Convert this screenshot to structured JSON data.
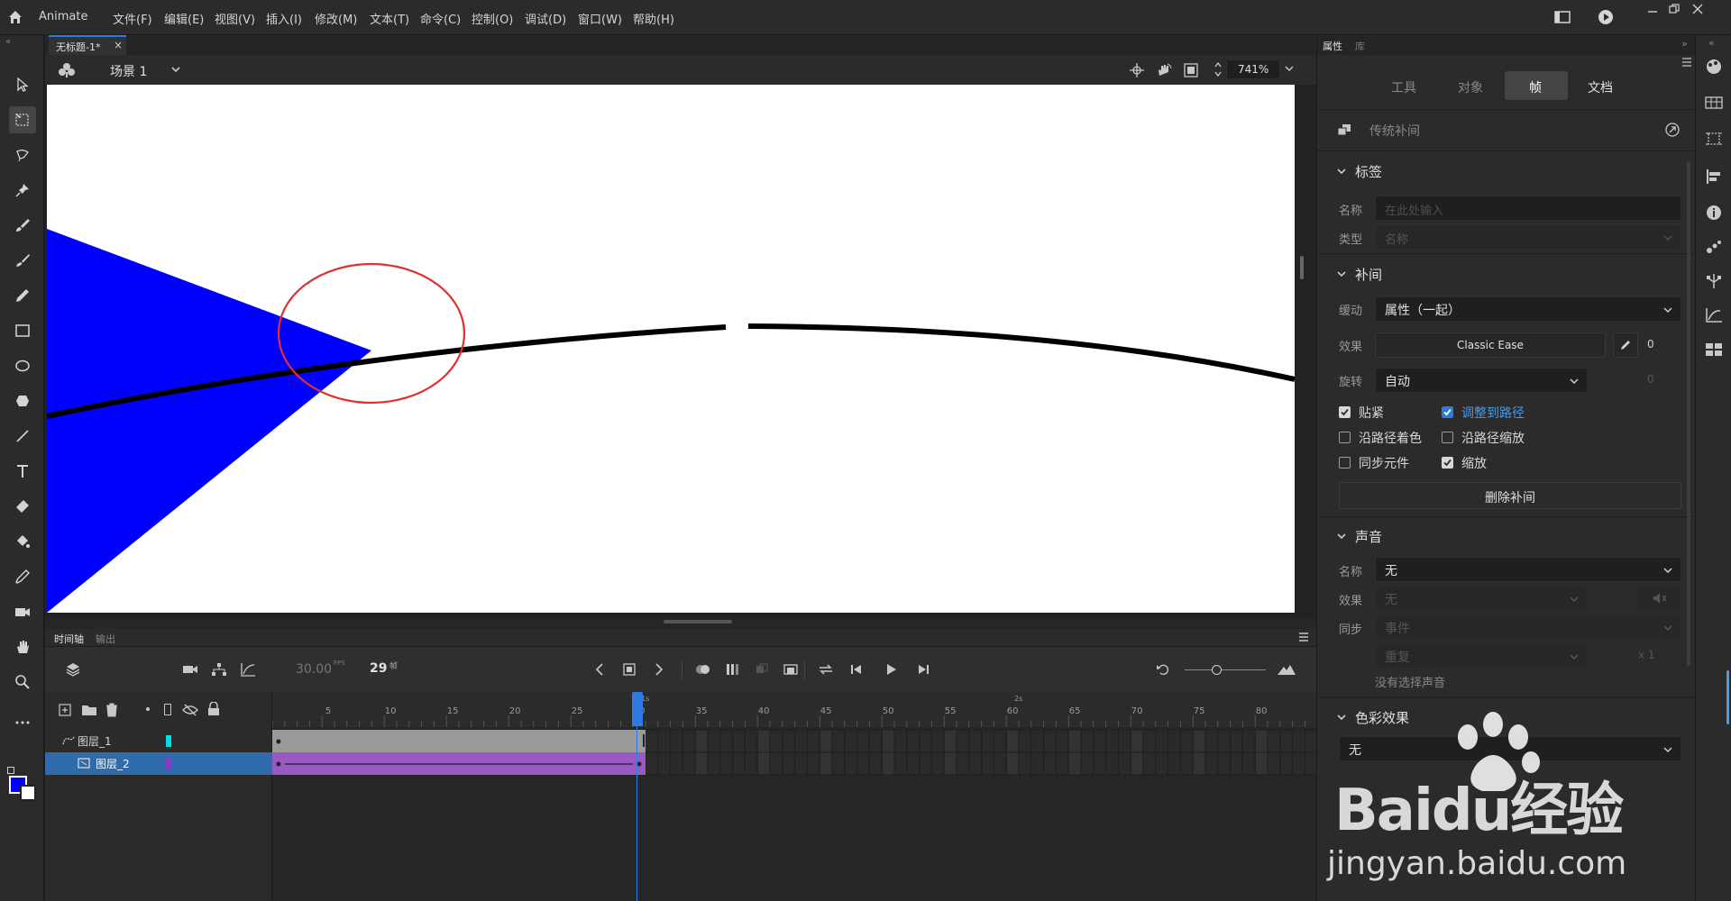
{
  "app": {
    "name": "Animate"
  },
  "menu": [
    "文件(F)",
    "编辑(E)",
    "视图(V)",
    "插入(I)",
    "修改(M)",
    "文本(T)",
    "命令(C)",
    "控制(O)",
    "调试(D)",
    "窗口(W)",
    "帮助(H)"
  ],
  "document": {
    "tab_title": "无标题-1*",
    "tab_close": "×",
    "scene": "场景 1",
    "zoom": "741%"
  },
  "timeline": {
    "tabs": [
      "时间轴",
      "输出"
    ],
    "fps": "30.00",
    "fps_unit": "FPS",
    "current_frame": "29",
    "frame_unit": "帧",
    "ruler_numbers": [
      "5",
      "10",
      "15",
      "20",
      "25",
      "30",
      "35",
      "40",
      "45",
      "50",
      "55",
      "60",
      "65",
      "70",
      "75",
      "80"
    ],
    "second_markers": [
      "1s",
      "2s"
    ],
    "layers": [
      {
        "name": "图层_1",
        "type": "guide",
        "color": "#00e0e0",
        "selected": false
      },
      {
        "name": "图层_2",
        "type": "guided",
        "color": "#9b30d0",
        "selected": true
      }
    ]
  },
  "properties": {
    "panel_tabs": [
      "属性",
      "库"
    ],
    "tabs": [
      "工具",
      "对象",
      "帧",
      "文档"
    ],
    "active_tab": "帧",
    "tween_type": "传统补间",
    "label_section": {
      "title": "标签",
      "name_label": "名称",
      "name_placeholder": "在此处输入",
      "type_label": "类型",
      "type_value": "名称"
    },
    "tween_section": {
      "title": "补间",
      "ease_label": "缓动",
      "ease_value": "属性（一起）",
      "effect_label": "效果",
      "effect_value": "Classic Ease",
      "effect_num": "0",
      "rotate_label": "旋转",
      "rotate_value": "自动",
      "rotate_num": "0",
      "checkboxes": [
        {
          "label": "贴紧",
          "checked": true
        },
        {
          "label": "调整到路径",
          "checked": true
        },
        {
          "label": "沿路径着色",
          "checked": false
        },
        {
          "label": "沿路径缩放",
          "checked": false
        },
        {
          "label": "同步元件",
          "checked": false
        },
        {
          "label": "缩放",
          "checked": true
        }
      ],
      "delete_button": "删除补间"
    },
    "sound_section": {
      "title": "声音",
      "name_label": "名称",
      "name_value": "无",
      "effect_label": "效果",
      "effect_value": "无",
      "sync_label": "同步",
      "sync_value": "事件",
      "repeat_value": "重复",
      "repeat_count": "x 1",
      "status": "没有选择声音"
    },
    "color_section": {
      "title": "色彩效果",
      "value": "无"
    }
  },
  "watermark": {
    "brand": "Baidu经验",
    "url": "jingyan.baidu.com"
  },
  "colors": {
    "stroke": "#0000ff",
    "fill": "#ffffff",
    "accent": "#2d7be0",
    "guided_layer": "#9b30d0"
  }
}
